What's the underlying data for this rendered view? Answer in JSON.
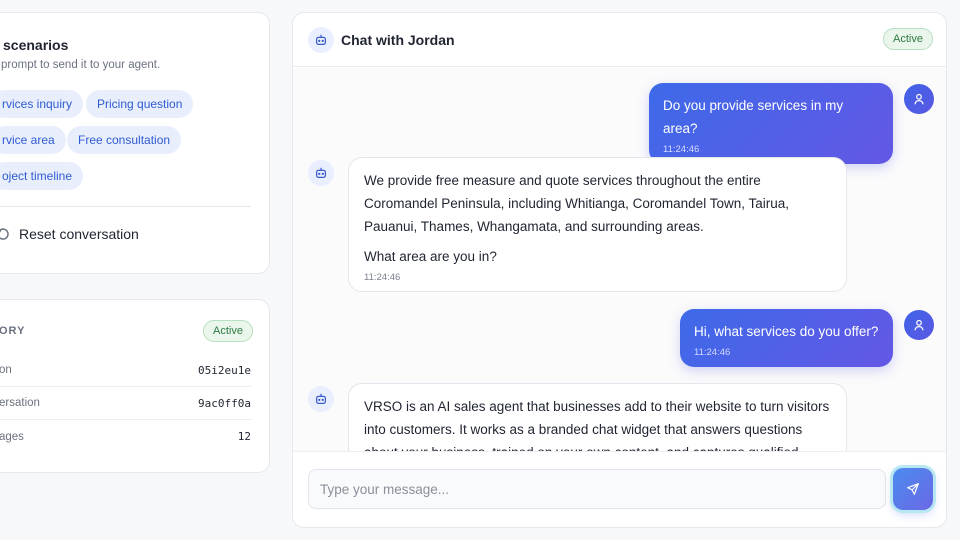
{
  "scenarios": {
    "title": "scenarios",
    "subtitle": "prompt to send it to your agent.",
    "chips": [
      "rvices inquiry",
      "Pricing question",
      "rvice area",
      "Free consultation",
      "oject timeline"
    ],
    "reset_label": "Reset conversation"
  },
  "stats": {
    "header": "ORY",
    "status": "Active",
    "rows": [
      {
        "label": "on",
        "value": "05i2eu1e"
      },
      {
        "label": "ersation",
        "value": "9ac0ff0a"
      },
      {
        "label": "ages",
        "value": "12"
      }
    ]
  },
  "chat": {
    "title": "Chat with Jordan",
    "status": "Active",
    "messages": [
      {
        "role": "user",
        "paragraphs": [
          "Do you provide services in my area?"
        ],
        "time": "11:24:46"
      },
      {
        "role": "bot",
        "paragraphs": [
          "We provide free measure and quote services throughout the entire Coromandel Peninsula, including Whitianga, Coromandel Town, Tairua, Pauanui, Thames, Whangamata, and surrounding areas.",
          "What area are you in?"
        ],
        "time": "11:24:46"
      },
      {
        "role": "user",
        "paragraphs": [
          "Hi, what services do you offer?"
        ],
        "time": "11:24:46"
      },
      {
        "role": "bot",
        "paragraphs": [
          "VRSO is an AI sales agent that businesses add to their website to turn visitors into customers. It works as a branded chat widget that answers questions about your business, trained on your own content, and captures qualified"
        ],
        "time": ""
      }
    ],
    "input_placeholder": "Type your message...",
    "send_icon": "send-icon"
  },
  "colors": {
    "accent": "#4a63e6",
    "chip_bg": "#e8eefc",
    "chip_text": "#2f5bd3",
    "active_badge_bg": "#eaf6ec",
    "active_badge_text": "#2f7a43"
  }
}
